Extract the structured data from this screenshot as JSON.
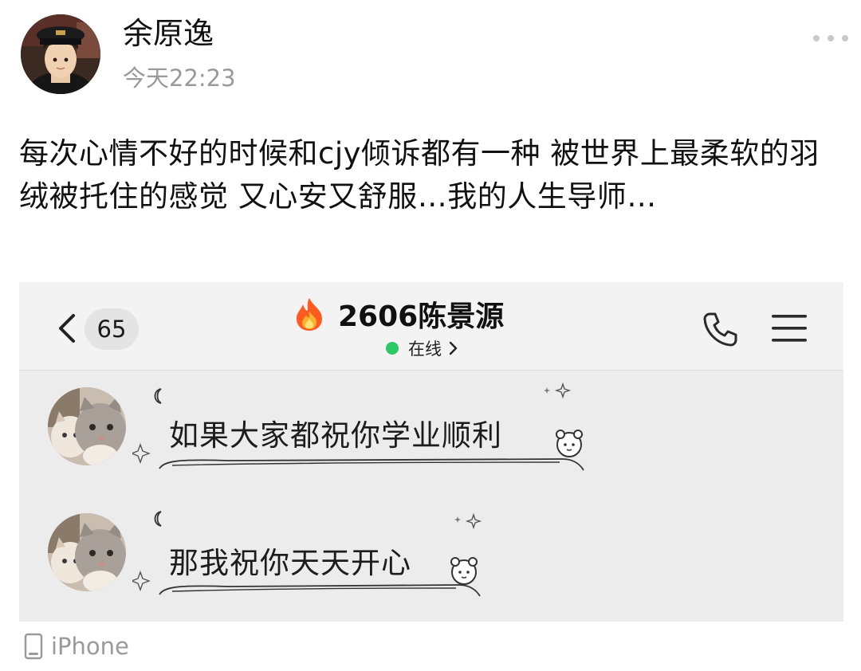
{
  "post": {
    "author": "余原逸",
    "time": "今天22:23",
    "text": "每次心情不好的时候和cjy倾诉都有一种 被世界上最柔软的羽绒被托住的感觉 又心安又舒服…我的人生导师…",
    "device": "iPhone"
  },
  "screenshot": {
    "header": {
      "unread_count": "65",
      "title": "2606陈景源",
      "status": "在线"
    },
    "messages": [
      {
        "text": "如果大家都祝你学业顺利"
      },
      {
        "text": "那我祝你天天开心"
      }
    ]
  },
  "icons": {
    "more": "more-dots-icon",
    "back": "chevron-left-icon",
    "fire": "fire-icon",
    "phone": "phone-icon",
    "menu": "hamburger-menu-icon",
    "device": "phone-device-icon"
  },
  "colors": {
    "online": "#2fc866",
    "muted_text": "#9a9a9a",
    "screenshot_bg": "#ececec"
  }
}
